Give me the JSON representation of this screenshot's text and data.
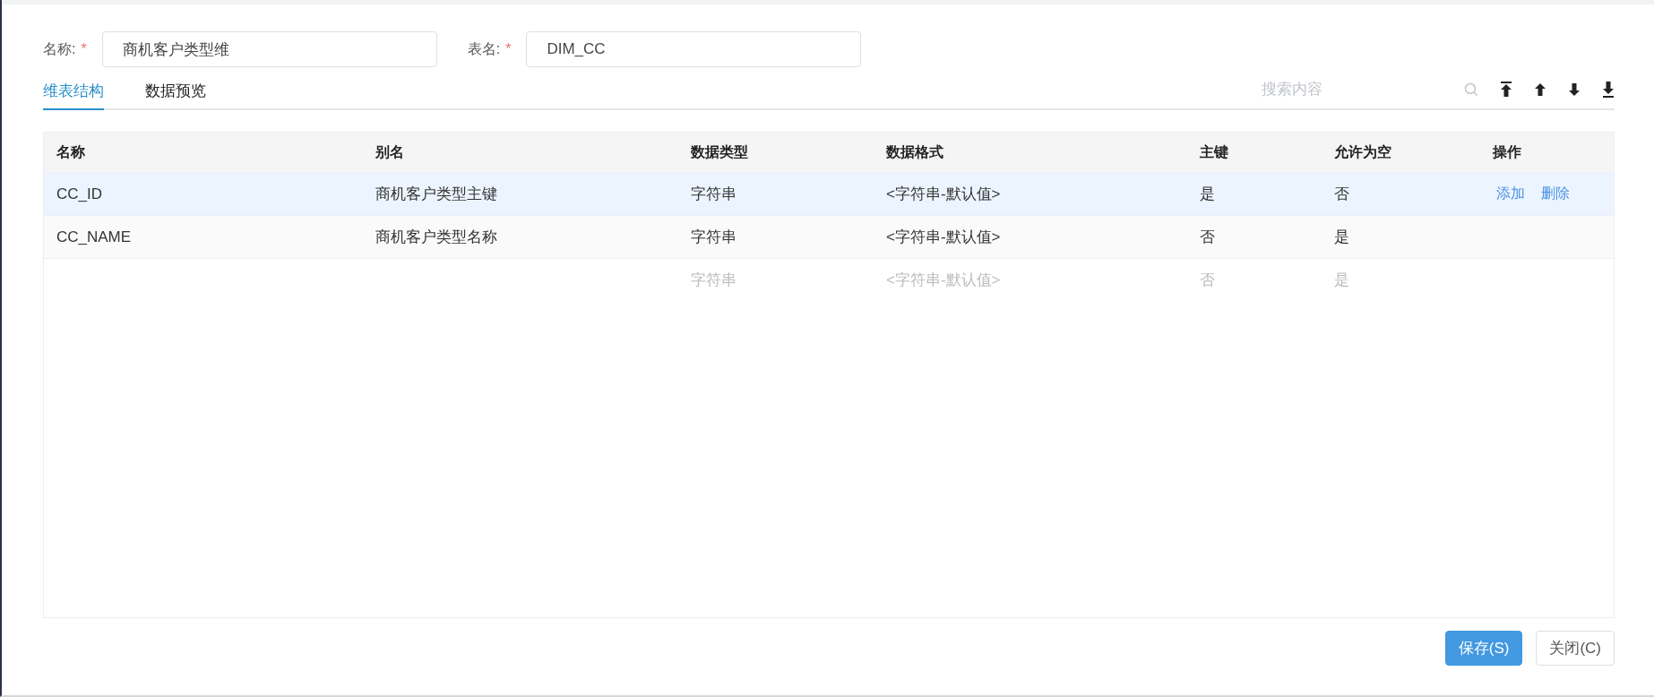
{
  "form": {
    "fields": [
      {
        "label": "名称:",
        "required_mark": "*",
        "value": "商机客户类型维"
      },
      {
        "label": "表名:",
        "required_mark": "*",
        "value": "DIM_CC"
      }
    ]
  },
  "tabs": [
    {
      "label": "维表结构",
      "selected": true
    },
    {
      "label": "数据预览",
      "selected": false
    }
  ],
  "search": {
    "placeholder": "搜索内容"
  },
  "table": {
    "columns": [
      "名称",
      "别名",
      "数据类型",
      "数据格式",
      "主键",
      "允许为空",
      "操作"
    ],
    "rows": [
      {
        "kind": "data",
        "selected": true,
        "cells": [
          "CC_ID",
          "商机客户类型主键",
          "字符串",
          "<字符串-默认值>",
          "是",
          "否"
        ],
        "actions": [
          "添加",
          "删除"
        ]
      },
      {
        "kind": "data",
        "selected": false,
        "cells": [
          "CC_NAME",
          "商机客户类型名称",
          "字符串",
          "<字符串-默认值>",
          "否",
          "是"
        ]
      },
      {
        "kind": "blank",
        "selected": false,
        "cells": [
          "",
          "",
          "字符串",
          "<字符串-默认值>",
          "否",
          "是"
        ]
      }
    ]
  },
  "buttons": [
    {
      "label": "保存(S)",
      "kind": "primary"
    },
    {
      "label": "关闭(C)",
      "kind": "default"
    }
  ]
}
